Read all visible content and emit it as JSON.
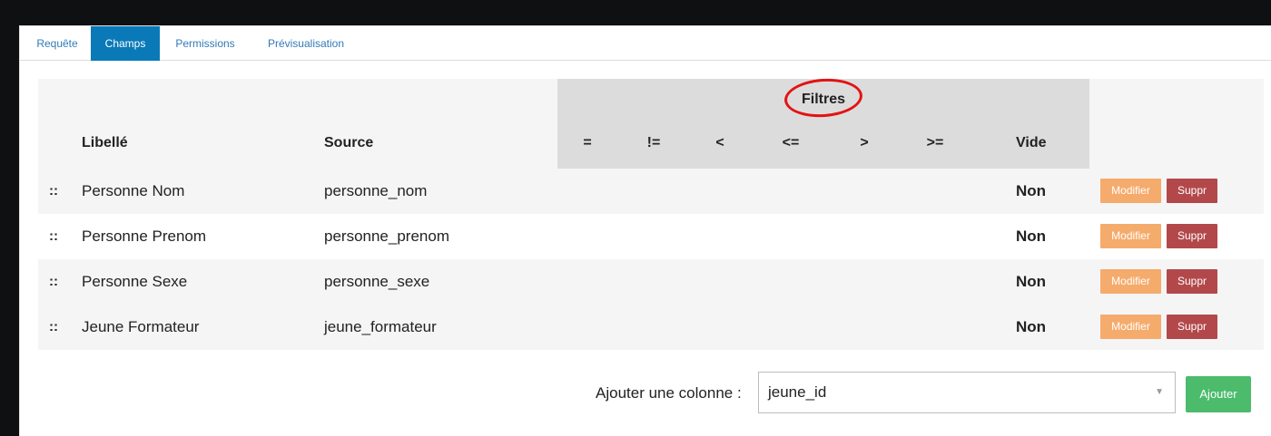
{
  "tabs": [
    {
      "label": "Requête",
      "active": false
    },
    {
      "label": "Champs",
      "active": true
    },
    {
      "label": "Permissions",
      "active": false
    },
    {
      "label": "Prévisualisation",
      "active": false
    }
  ],
  "table": {
    "headers": {
      "libelle": "Libellé",
      "source": "Source",
      "filters_title": "Filtres",
      "ops": [
        "=",
        "!=",
        "<",
        "<=",
        ">",
        ">="
      ],
      "vide": "Vide"
    },
    "rows": [
      {
        "handle": "::",
        "label": "Personne Nom",
        "source": "personne_nom",
        "vide": "Non",
        "edit": "Modifier",
        "delete": "Suppr"
      },
      {
        "handle": "::",
        "label": "Personne Prenom",
        "source": "personne_prenom",
        "vide": "Non",
        "edit": "Modifier",
        "delete": "Suppr"
      },
      {
        "handle": "::",
        "label": "Personne Sexe",
        "source": "personne_sexe",
        "vide": "Non",
        "edit": "Modifier",
        "delete": "Suppr"
      },
      {
        "handle": "::",
        "label": "Jeune Formateur",
        "source": "jeune_formateur",
        "vide": "Non",
        "edit": "Modifier",
        "delete": "Suppr"
      }
    ]
  },
  "add_column": {
    "label": "Ajouter une colonne :",
    "selected": "jeune_id",
    "button": "Ajouter"
  },
  "colors": {
    "tab_active": "#0a79b8",
    "edit_button": "#f5ab6c",
    "delete_button": "#b3484b",
    "add_button": "#4cbb6c",
    "annotation_circle": "#e31313"
  }
}
